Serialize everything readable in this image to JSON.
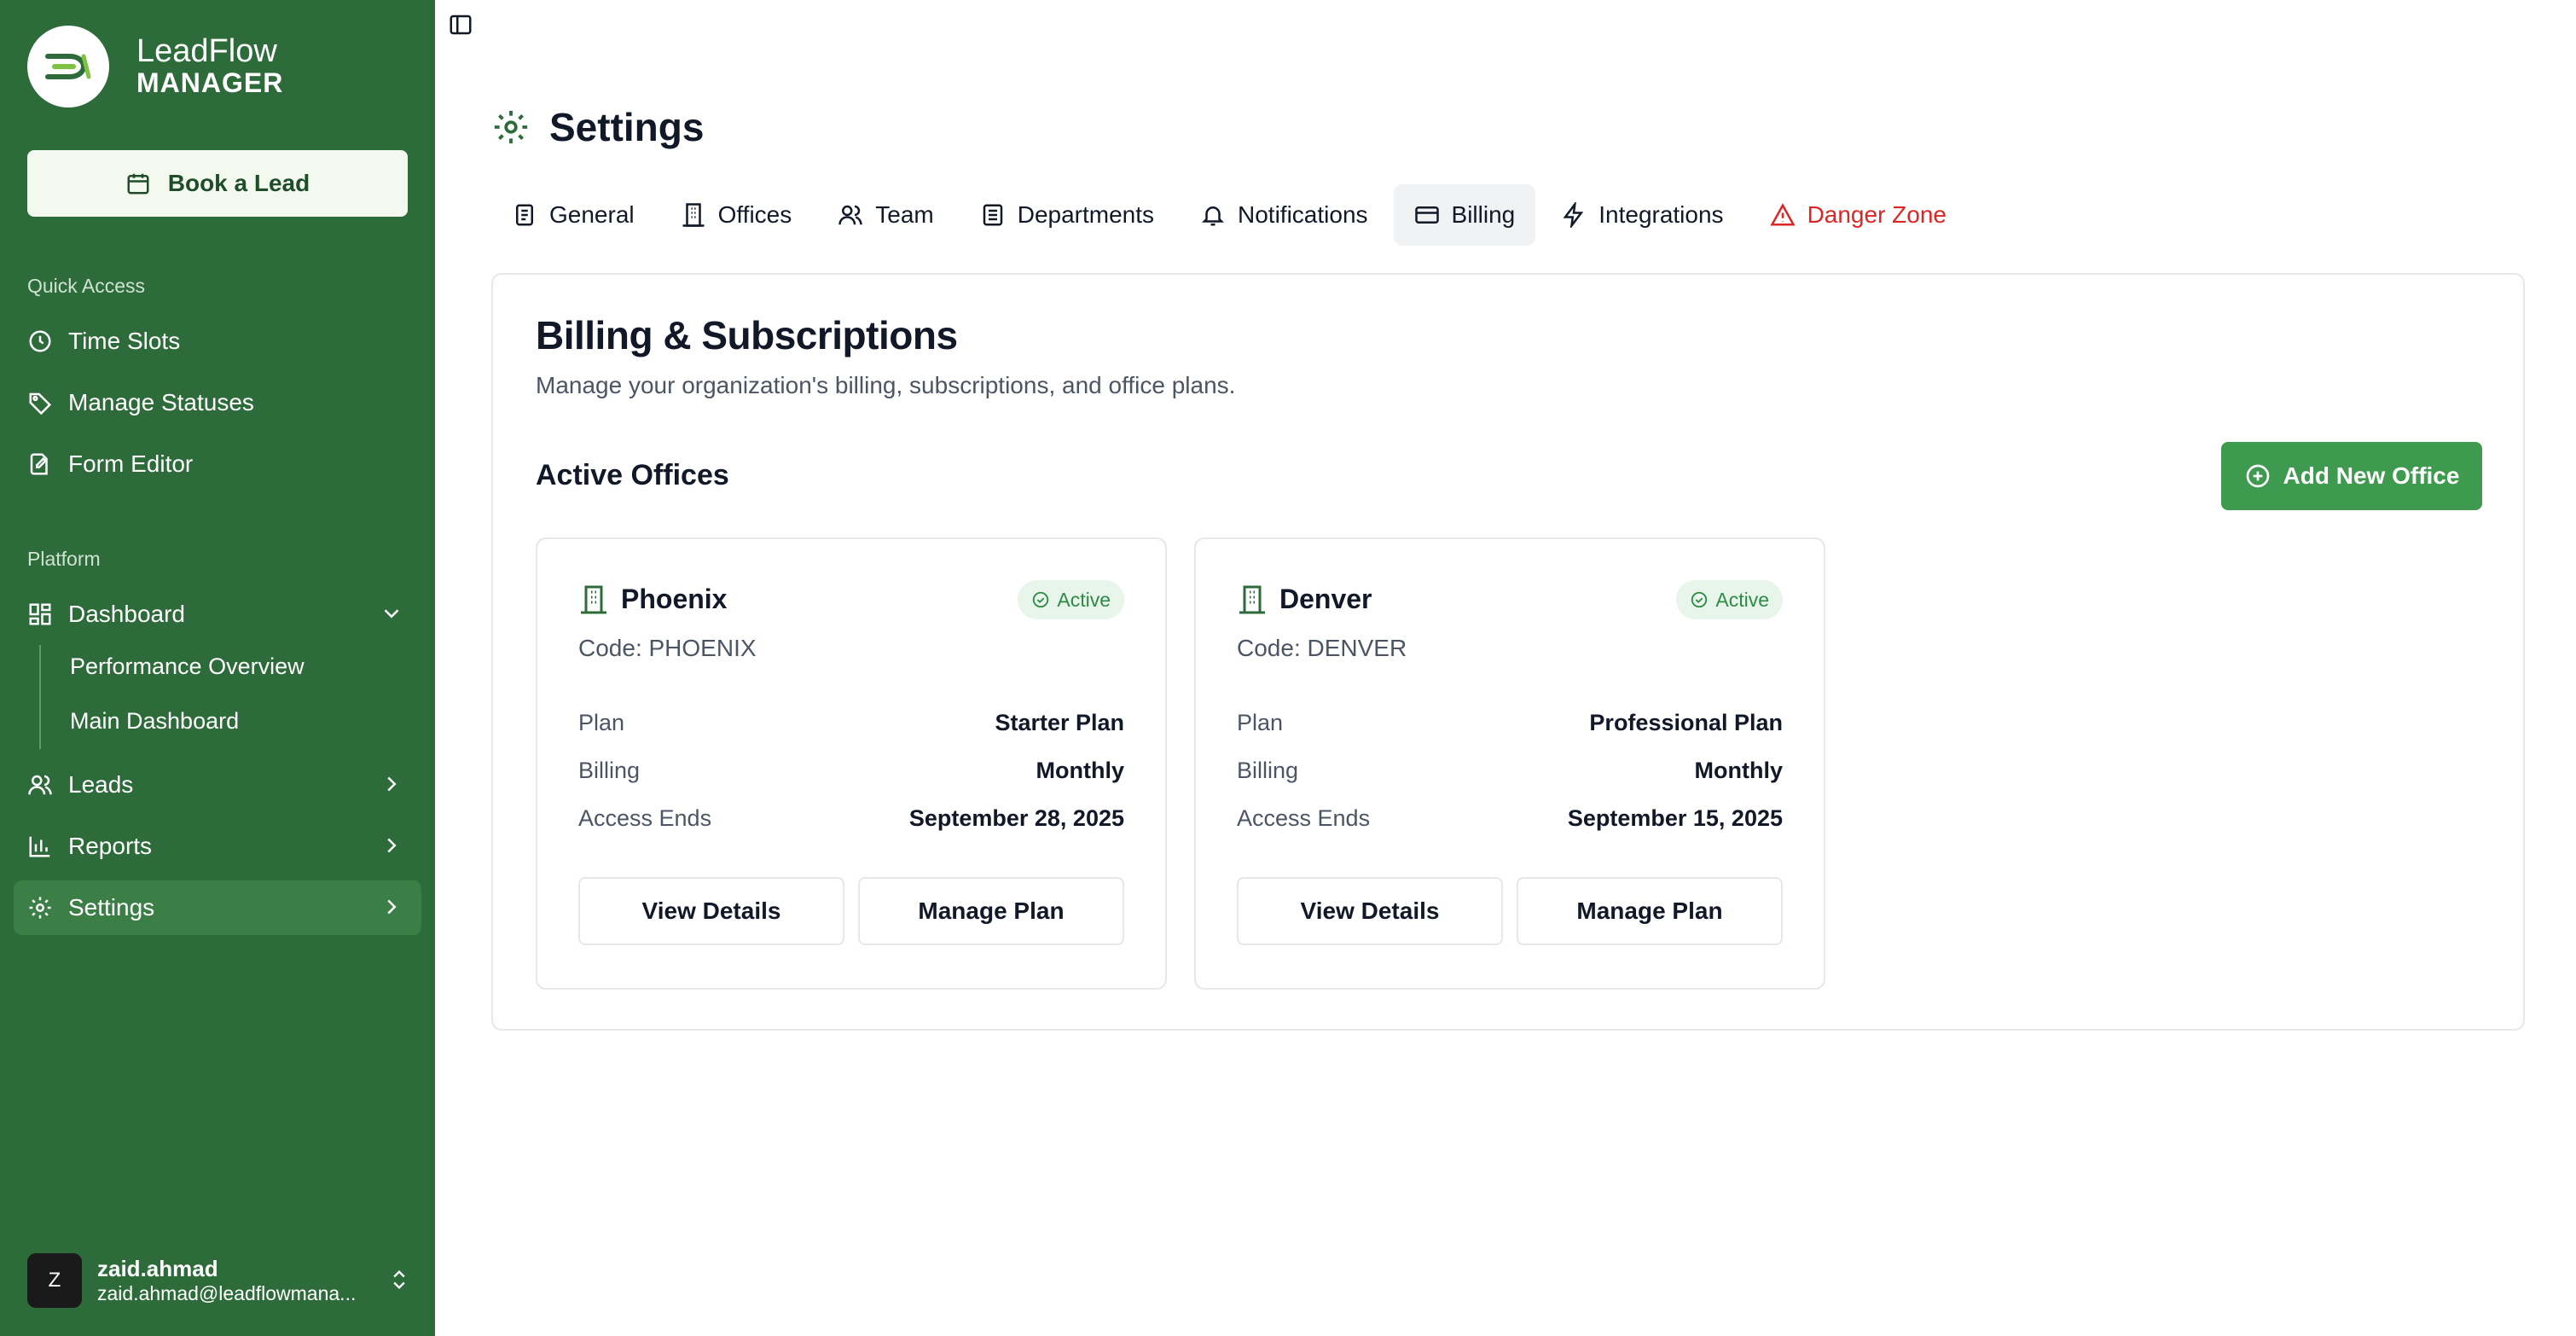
{
  "brand": {
    "name": "LeadFlow",
    "sub": "MANAGER"
  },
  "book_button": "Book a Lead",
  "sidebar": {
    "quick_access_label": "Quick Access",
    "quick_items": [
      {
        "label": "Time Slots",
        "icon": "clock-icon"
      },
      {
        "label": "Manage Statuses",
        "icon": "tag-icon"
      },
      {
        "label": "Form Editor",
        "icon": "form-icon"
      }
    ],
    "platform_label": "Platform",
    "platform_items": [
      {
        "label": "Dashboard",
        "icon": "dashboard-icon",
        "chevron": "down"
      },
      {
        "label": "Leads",
        "icon": "users-icon",
        "chevron": "right"
      },
      {
        "label": "Reports",
        "icon": "bar-chart-icon",
        "chevron": "right"
      },
      {
        "label": "Settings",
        "icon": "gear-icon",
        "chevron": "right",
        "active": true
      }
    ],
    "dashboard_sub": [
      "Performance Overview",
      "Main Dashboard"
    ]
  },
  "user": {
    "initial": "Z",
    "name": "zaid.ahmad",
    "email": "zaid.ahmad@leadflowmana..."
  },
  "page_title": "Settings",
  "tabs": [
    {
      "label": "General",
      "icon": "document-icon"
    },
    {
      "label": "Offices",
      "icon": "building-icon"
    },
    {
      "label": "Team",
      "icon": "team-icon"
    },
    {
      "label": "Departments",
      "icon": "departments-icon"
    },
    {
      "label": "Notifications",
      "icon": "bell-icon"
    },
    {
      "label": "Billing",
      "icon": "credit-card-icon",
      "active": true
    },
    {
      "label": "Integrations",
      "icon": "lightning-icon"
    },
    {
      "label": "Danger Zone",
      "icon": "warning-icon",
      "danger": true
    }
  ],
  "billing": {
    "title": "Billing & Subscriptions",
    "description": "Manage your organization's billing, subscriptions, and office plans.",
    "active_offices_label": "Active Offices",
    "add_button": "Add New Office"
  },
  "offices": [
    {
      "name": "Phoenix",
      "status": "Active",
      "code": "Code: PHOENIX",
      "plan_label": "Plan",
      "plan": "Starter Plan",
      "billing_label": "Billing",
      "billing": "Monthly",
      "access_label": "Access Ends",
      "access_ends": "September 28, 2025",
      "view_button": "View Details",
      "manage_button": "Manage Plan"
    },
    {
      "name": "Denver",
      "status": "Active",
      "code": "Code: DENVER",
      "plan_label": "Plan",
      "plan": "Professional Plan",
      "billing_label": "Billing",
      "billing": "Monthly",
      "access_label": "Access Ends",
      "access_ends": "September 15, 2025",
      "view_button": "View Details",
      "manage_button": "Manage Plan"
    }
  ],
  "colors": {
    "sidebar": "#2e6b3a",
    "accent": "#3e9a4e",
    "danger": "#dc2626",
    "badge_bg": "#e7f5ea"
  }
}
